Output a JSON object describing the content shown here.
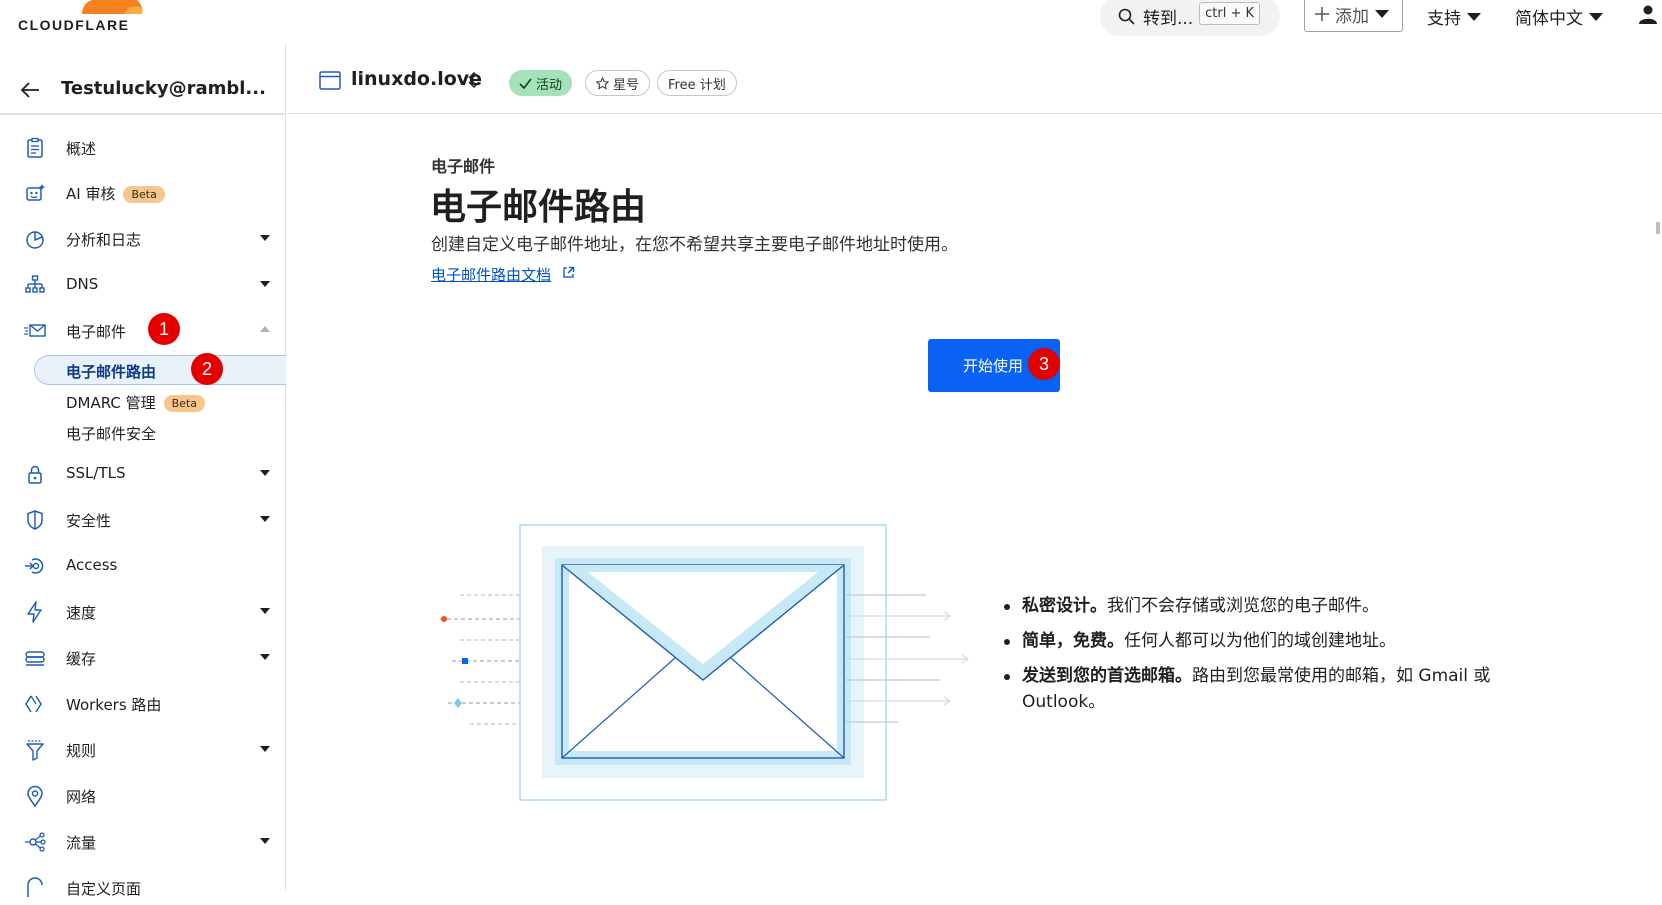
{
  "brand": {
    "name": "CLOUDFLARE",
    "orange": "#f6821f",
    "accent": "#0a62f5"
  },
  "topbar": {
    "search_label": "转到...",
    "search_shortcut": "ctrl + K",
    "add_label": "添加",
    "support_label": "支持",
    "language_label": "简体中文"
  },
  "sidebar": {
    "account_name": "Testulucky@rambl...",
    "items": [
      {
        "label": "概述",
        "icon": "clipboard-icon"
      },
      {
        "label": "AI 审核",
        "icon": "robot-icon",
        "badge": "Beta"
      },
      {
        "label": "分析和日志",
        "icon": "pie-chart-icon"
      },
      {
        "label": "DNS",
        "icon": "network-tree-icon"
      },
      {
        "label": "电子邮件",
        "icon": "envelope-fast-icon"
      },
      {
        "label": "SSL/TLS",
        "icon": "lock-icon"
      },
      {
        "label": "安全性",
        "icon": "shield-icon"
      },
      {
        "label": "Access",
        "icon": "access-icon"
      },
      {
        "label": "速度",
        "icon": "lightning-icon"
      },
      {
        "label": "缓存",
        "icon": "database-icon"
      },
      {
        "label": "Workers 路由",
        "icon": "workers-icon"
      },
      {
        "label": "规则",
        "icon": "funnel-icon"
      },
      {
        "label": "网络",
        "icon": "location-pin-icon"
      },
      {
        "label": "流量",
        "icon": "traffic-nodes-icon"
      },
      {
        "label": "自定义页面",
        "icon": "custom-page-icon"
      }
    ],
    "email_sub": [
      {
        "label": "电子邮件路由"
      },
      {
        "label": "DMARC 管理",
        "badge": "Beta"
      },
      {
        "label": "电子邮件安全"
      }
    ],
    "annotations": [
      "1",
      "2"
    ]
  },
  "zone": {
    "name": "linuxdo.love",
    "status": "活动",
    "star": "星号",
    "plan": "Free 计划"
  },
  "main": {
    "eyebrow": "电子邮件",
    "title": "电子邮件路由",
    "description": "创建自定义电子邮件地址，在您不希望共享主要电子邮件地址时使用。",
    "doc_link": "电子邮件路由文档",
    "cta_label": "开始使用",
    "cta_annotation": "3",
    "benefits": [
      {
        "bold": "私密设计。",
        "text": "我们不会存储或浏览您的电子邮件。"
      },
      {
        "bold": "简单，免费。",
        "text": "任何人都可以为他们的域创建地址。"
      },
      {
        "bold": "发送到您的首选邮箱。",
        "text": "路由到您最常使用的邮箱，如 Gmail 或 Outlook。"
      }
    ]
  }
}
